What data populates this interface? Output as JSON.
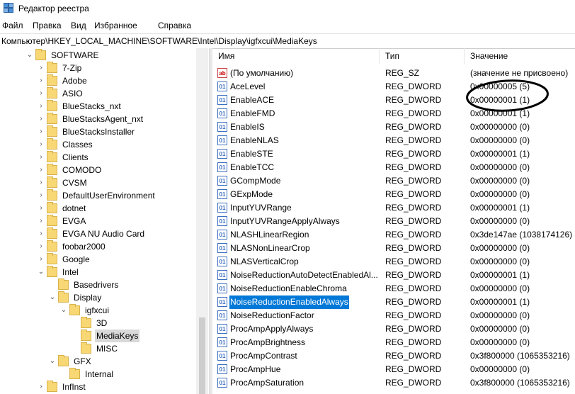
{
  "window": {
    "title": "Редактор реестра"
  },
  "menu": [
    "Файл",
    "Правка",
    "Вид",
    "Избранное",
    "Справка"
  ],
  "address": "Компьютер\\HKEY_LOCAL_MACHINE\\SOFTWARE\\Intel\\Display\\igfxcui\\MediaKeys",
  "tree": [
    {
      "label": "SOFTWARE",
      "expanded": true
    },
    {
      "label": "7-Zip"
    },
    {
      "label": "Adobe"
    },
    {
      "label": "ASIO"
    },
    {
      "label": "BlueStacks_nxt"
    },
    {
      "label": "BlueStacksAgent_nxt"
    },
    {
      "label": "BlueStacksInstaller"
    },
    {
      "label": "Classes"
    },
    {
      "label": "Clients"
    },
    {
      "label": "COMODO"
    },
    {
      "label": "CVSM"
    },
    {
      "label": "DefaultUserEnvironment"
    },
    {
      "label": "dotnet"
    },
    {
      "label": "EVGA"
    },
    {
      "label": "EVGA NU Audio Card"
    },
    {
      "label": "foobar2000"
    },
    {
      "label": "Google"
    },
    {
      "label": "Intel",
      "expanded": true
    },
    {
      "label": "Basedrivers"
    },
    {
      "label": "Display",
      "expanded": true
    },
    {
      "label": "igfxcui",
      "expanded": true
    },
    {
      "label": "3D"
    },
    {
      "label": "MediaKeys",
      "selected": true
    },
    {
      "label": "MISC"
    },
    {
      "label": "GFX",
      "expanded": true
    },
    {
      "label": "Internal"
    },
    {
      "label": "InfInst"
    }
  ],
  "columns": {
    "name": "Имя",
    "type": "Тип",
    "value": "Значение"
  },
  "entries": [
    {
      "name": "(По умолчанию)",
      "type": "REG_SZ",
      "value": "(значение не присвоено)",
      "icon": "string-value-icon"
    },
    {
      "name": "AceLevel",
      "type": "REG_DWORD",
      "value": "0x00000005 (5)",
      "icon": "dword-value-icon"
    },
    {
      "name": "EnableACE",
      "type": "REG_DWORD",
      "value": "0x00000001 (1)",
      "icon": "dword-value-icon"
    },
    {
      "name": "EnableFMD",
      "type": "REG_DWORD",
      "value": "0x00000001 (1)",
      "icon": "dword-value-icon"
    },
    {
      "name": "EnableIS",
      "type": "REG_DWORD",
      "value": "0x00000000 (0)",
      "icon": "dword-value-icon"
    },
    {
      "name": "EnableNLAS",
      "type": "REG_DWORD",
      "value": "0x00000000 (0)",
      "icon": "dword-value-icon"
    },
    {
      "name": "EnableSTE",
      "type": "REG_DWORD",
      "value": "0x00000001 (1)",
      "icon": "dword-value-icon"
    },
    {
      "name": "EnableTCC",
      "type": "REG_DWORD",
      "value": "0x00000000 (0)",
      "icon": "dword-value-icon"
    },
    {
      "name": "GCompMode",
      "type": "REG_DWORD",
      "value": "0x00000000 (0)",
      "icon": "dword-value-icon"
    },
    {
      "name": "GExpMode",
      "type": "REG_DWORD",
      "value": "0x00000000 (0)",
      "icon": "dword-value-icon"
    },
    {
      "name": "InputYUVRange",
      "type": "REG_DWORD",
      "value": "0x00000001 (1)",
      "icon": "dword-value-icon"
    },
    {
      "name": "InputYUVRangeApplyAlways",
      "type": "REG_DWORD",
      "value": "0x00000000 (0)",
      "icon": "dword-value-icon"
    },
    {
      "name": "NLASHLinearRegion",
      "type": "REG_DWORD",
      "value": "0x3de147ae (1038174126)",
      "icon": "dword-value-icon"
    },
    {
      "name": "NLASNonLinearCrop",
      "type": "REG_DWORD",
      "value": "0x00000000 (0)",
      "icon": "dword-value-icon"
    },
    {
      "name": "NLASVerticalCrop",
      "type": "REG_DWORD",
      "value": "0x00000000 (0)",
      "icon": "dword-value-icon"
    },
    {
      "name": "NoiseReductionAutoDetectEnabledAl...",
      "type": "REG_DWORD",
      "value": "0x00000001 (1)",
      "icon": "dword-value-icon"
    },
    {
      "name": "NoiseReductionEnableChroma",
      "type": "REG_DWORD",
      "value": "0x00000000 (0)",
      "icon": "dword-value-icon"
    },
    {
      "name": "NoiseReductionEnabledAlways",
      "type": "REG_DWORD",
      "value": "0x00000001 (1)",
      "icon": "dword-value-icon",
      "selected": true
    },
    {
      "name": "NoiseReductionFactor",
      "type": "REG_DWORD",
      "value": "0x00000000 (0)",
      "icon": "dword-value-icon"
    },
    {
      "name": "ProcAmpApplyAlways",
      "type": "REG_DWORD",
      "value": "0x00000000 (0)",
      "icon": "dword-value-icon"
    },
    {
      "name": "ProcAmpBrightness",
      "type": "REG_DWORD",
      "value": "0x00000000 (0)",
      "icon": "dword-value-icon"
    },
    {
      "name": "ProcAmpContrast",
      "type": "REG_DWORD",
      "value": "0x3f800000 (1065353216)",
      "icon": "dword-value-icon"
    },
    {
      "name": "ProcAmpHue",
      "type": "REG_DWORD",
      "value": "0x00000000 (0)",
      "icon": "dword-value-icon"
    },
    {
      "name": "ProcAmpSaturation",
      "type": "REG_DWORD",
      "value": "0x3f800000 (1065353216)",
      "icon": "dword-value-icon"
    }
  ],
  "colors": {
    "selection": "#0078d7",
    "tree_selection": "#d9d9d9",
    "folder": "#f8d775",
    "annotation": "#000000"
  }
}
